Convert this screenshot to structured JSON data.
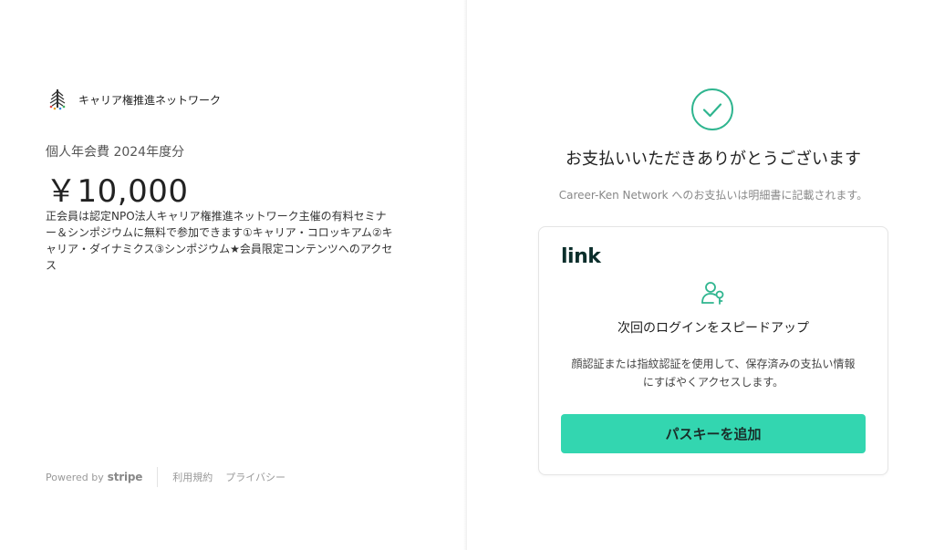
{
  "merchant": {
    "name": "キャリア権推進ネットワーク",
    "logo_icon": "tree-logo-icon"
  },
  "product": {
    "title": "個人年会費 2024年度分",
    "amount": "￥10,000",
    "description": "正会員は認定NPO法人キャリア権推進ネットワーク主催の有料セミナー＆シンポジウムに無料で参加できます①キャリア・コロッキアム②キャリア・ダイナミクス③シンポジウム★会員限定コンテンツへのアクセス"
  },
  "footer": {
    "powered_by": "Powered by",
    "stripe": "stripe",
    "terms": "利用規約",
    "privacy": "プライバシー"
  },
  "success": {
    "icon": "check-circle-icon",
    "title": "お支払いいただきありがとうございます",
    "note": "Career-Ken Network へのお支払いは明細書に記載されます。"
  },
  "link_card": {
    "logo": "link",
    "icon": "user-key-icon",
    "title": "次回のログインをスピードアップ",
    "description": "顔認証または指紋認証を使用して、保存済みの支払い情報にすばやくアクセスします。",
    "button_label": "パスキーを追加"
  },
  "colors": {
    "accent_green": "#33d6b0",
    "success_green": "#2fb58f"
  }
}
